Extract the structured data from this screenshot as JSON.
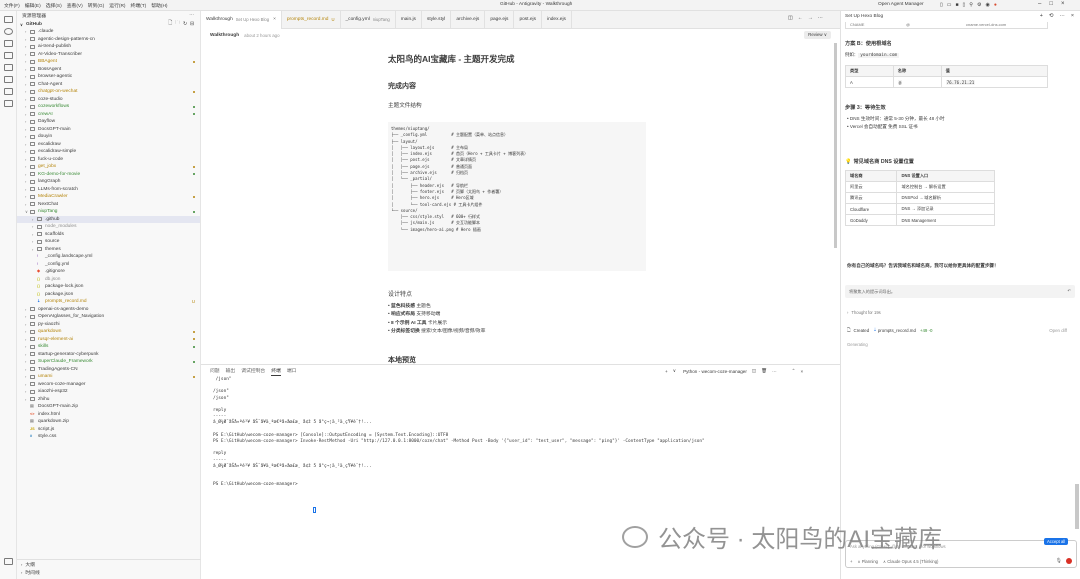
{
  "titlebar": {
    "menu": [
      "文件(F)",
      "编辑(E)",
      "选择(S)",
      "查看(V)",
      "转到(G)",
      "运行(R)",
      "终端(T)",
      "帮助(H)"
    ],
    "title": "GitHub - Antigravity - Walkthrough",
    "agent_manager": "Open Agent Manager"
  },
  "sidebar": {
    "title": "资源管理器",
    "root": "GitHub",
    "items": [
      {
        "t": "f",
        "d": 0,
        "label": ".claude",
        "c": "#3b3b3b"
      },
      {
        "t": "f",
        "d": 0,
        "label": "agentic-design-patterns-cn",
        "c": "#3b3b3b"
      },
      {
        "t": "f",
        "d": 0,
        "label": "ai-trend-publish",
        "c": "#3b3b3b"
      },
      {
        "t": "f",
        "d": 0,
        "label": "AI-Video-Transcriber",
        "c": "#3b3b3b"
      },
      {
        "t": "f",
        "d": 0,
        "label": "BBAgent",
        "c": "#b5850b",
        "dot": "#b5850b"
      },
      {
        "t": "f",
        "d": 0,
        "label": "BossAgent",
        "c": "#3b3b3b"
      },
      {
        "t": "f",
        "d": 0,
        "label": "browser-agentic",
        "c": "#3b3b3b"
      },
      {
        "t": "f",
        "d": 0,
        "label": "Chat-Agent",
        "c": "#3b3b3b"
      },
      {
        "t": "f",
        "d": 0,
        "label": "chatgpt-on-wechat",
        "c": "#b5850b",
        "dot": "#b5850b"
      },
      {
        "t": "f",
        "d": 0,
        "label": "coze-studio",
        "c": "#3b3b3b"
      },
      {
        "t": "f",
        "d": 0,
        "label": "cozeworkflows",
        "c": "#388a34",
        "dot": "#388a34"
      },
      {
        "t": "f",
        "d": 0,
        "label": "crewAI",
        "c": "#388a34",
        "dot": "#388a34"
      },
      {
        "t": "f",
        "d": 0,
        "label": "Dayflow",
        "c": "#3b3b3b"
      },
      {
        "t": "f",
        "d": 0,
        "label": "DocsGPT-main",
        "c": "#3b3b3b"
      },
      {
        "t": "f",
        "d": 0,
        "label": "douyin",
        "c": "#3b3b3b"
      },
      {
        "t": "f",
        "d": 0,
        "label": "excalidraw",
        "c": "#3b3b3b"
      },
      {
        "t": "f",
        "d": 0,
        "label": "excalidraw-simple",
        "c": "#3b3b3b"
      },
      {
        "t": "f",
        "d": 0,
        "label": "fuck-u-code",
        "c": "#3b3b3b"
      },
      {
        "t": "f",
        "d": 0,
        "label": "get_jobx",
        "c": "#b5850b",
        "dot": "#b5850b"
      },
      {
        "t": "f",
        "d": 0,
        "label": "KG-demo-for-movie",
        "c": "#388a34",
        "dot": "#388a34"
      },
      {
        "t": "f",
        "d": 0,
        "label": "langGraph",
        "c": "#3b3b3b"
      },
      {
        "t": "f",
        "d": 0,
        "label": "LLMs-from-scratch",
        "c": "#3b3b3b"
      },
      {
        "t": "f",
        "d": 0,
        "label": "MediaCrawler",
        "c": "#b5850b",
        "dot": "#b5850b"
      },
      {
        "t": "f",
        "d": 0,
        "label": "NextChat",
        "c": "#3b3b3b"
      },
      {
        "t": "o",
        "d": 0,
        "label": "niupTang",
        "c": "#388a34",
        "dot": "#388a34"
      },
      {
        "t": "f",
        "d": 1,
        "label": ".github",
        "c": "#3b3b3b",
        "sel": true
      },
      {
        "t": "f",
        "d": 1,
        "label": "node_modules",
        "c": "#8e8e8e"
      },
      {
        "t": "f",
        "d": 1,
        "label": "scaffolds",
        "c": "#3b3b3b"
      },
      {
        "t": "f",
        "d": 1,
        "label": "source",
        "c": "#3b3b3b"
      },
      {
        "t": "f",
        "d": 1,
        "label": "themes",
        "c": "#3b3b3b"
      },
      {
        "t": "y",
        "d": 1,
        "label": "_config.landscape.yml",
        "c": "#3b3b3b"
      },
      {
        "t": "y",
        "d": 1,
        "label": "_config.yml",
        "c": "#3b3b3b"
      },
      {
        "t": "g",
        "d": 1,
        "label": ".gitignore",
        "c": "#3b3b3b"
      },
      {
        "t": "x",
        "d": 1,
        "label": "db.json",
        "c": "#8e8e8e"
      },
      {
        "t": "x",
        "d": 1,
        "label": "package-lock.json",
        "c": "#3b3b3b"
      },
      {
        "t": "x",
        "d": 1,
        "label": "package.json",
        "c": "#3b3b3b"
      },
      {
        "t": "m",
        "d": 1,
        "label": "prompts_record.md",
        "c": "#b5850b",
        "badge": "U"
      },
      {
        "t": "f",
        "d": 0,
        "label": "openai-cs-agents-demo",
        "c": "#3b3b3b"
      },
      {
        "t": "f",
        "d": 0,
        "label": "OpenAIglasses_for_Navigation",
        "c": "#3b3b3b"
      },
      {
        "t": "f",
        "d": 0,
        "label": "py-xiaozhi",
        "c": "#3b3b3b"
      },
      {
        "t": "f",
        "d": 0,
        "label": "quarkdown",
        "c": "#b5850b",
        "dot": "#b5850b"
      },
      {
        "t": "f",
        "d": 0,
        "label": "rusqr-element-ai",
        "c": "#b5850b",
        "dot": "#b5850b"
      },
      {
        "t": "f",
        "d": 0,
        "label": "skills",
        "c": "#388a34",
        "dot": "#388a34"
      },
      {
        "t": "f",
        "d": 0,
        "label": "startup-generator-cyberpunk",
        "c": "#3b3b3b"
      },
      {
        "t": "f",
        "d": 0,
        "label": "SuperClaude_Framework",
        "c": "#388a34",
        "dot": "#388a34"
      },
      {
        "t": "f",
        "d": 0,
        "label": "TradingAgents-CN",
        "c": "#3b3b3b"
      },
      {
        "t": "f",
        "d": 0,
        "label": "umami",
        "c": "#b5850b",
        "dot": "#b5850b"
      },
      {
        "t": "f",
        "d": 0,
        "label": "wecom-coze-manager",
        "c": "#3b3b3b"
      },
      {
        "t": "f",
        "d": 0,
        "label": "xiaozhi-esp32",
        "c": "#3b3b3b"
      },
      {
        "t": "f",
        "d": 0,
        "label": "zhihu",
        "c": "#3b3b3b"
      },
      {
        "t": "z",
        "d": 0,
        "label": "DocsGPT-main.zip",
        "c": "#3b3b3b"
      },
      {
        "t": "h",
        "d": 0,
        "label": "index.html",
        "c": "#3b3b3b"
      },
      {
        "t": "z",
        "d": 0,
        "label": "quarkdown.zip",
        "c": "#3b3b3b"
      },
      {
        "t": "j",
        "d": 0,
        "label": "script.js",
        "c": "#3b3b3b"
      },
      {
        "t": "c",
        "d": 0,
        "label": "style.css",
        "c": "#3b3b3b"
      }
    ],
    "outline": "大纲",
    "timeline": "时间线"
  },
  "tabs": [
    {
      "label": "Walkthrough",
      "sub": "Set Up Hexo Blog",
      "active": true,
      "close": "×"
    },
    {
      "label": "prompts_record.md",
      "sub": "U",
      "color": "#b5850b"
    },
    {
      "label": "_config.yml",
      "sub": "niupTang"
    },
    {
      "label": "main.js"
    },
    {
      "label": "style.styl"
    },
    {
      "label": "archive.ejs"
    },
    {
      "label": "page.ejs"
    },
    {
      "label": "post.ejs"
    },
    {
      "label": "index.ejs"
    }
  ],
  "crumb": {
    "title": "Walkthrough",
    "time": "about 2 hours ago",
    "review": "Review"
  },
  "doc": {
    "h1": "太阳鸟的AI宝藏库 - 主题开发完成",
    "h2": "完成内容",
    "h3": "主题文件结构",
    "code": "themes/niuptang/\n├── _config.yml          # 主题配置（菜单、站点信息）\n├── layout/\n│   ├── layout.ejs       # 主布局\n│   ├── index.ejs        # 首页（Hero + 工具卡片 + 博客列表）\n│   ├── post.ejs         # 文章详情页\n│   ├── page.ejs         # 普通页面\n│   ├── archive.ejs      # 归档页\n│   └── _partial/\n│       ├── header.ejs   # 导航栏\n│       ├── footer.ejs   # 页脚（太阳鸟 + 作者署）\n│       ├── hero.ejs     # Hero区域\n│       └── tool-card.ejs # 工具卡片组件\n└── source/\n    ├── css/style.styl   # 600+ 行样式\n    ├── js/main.js       # 交互功能脚本\n    └── images/hero-ai.png # Hero 插画",
    "h2b": "设计特点",
    "bullets": [
      {
        "b": "蓝色科技感",
        "t": " 主题色"
      },
      {
        "b": "响应式布局",
        "t": " 支持移动端"
      },
      {
        "b": "8 个示例 AI 工具",
        "t": " 卡片展示"
      },
      {
        "b": "分类标签切换",
        "t": " 搜索/文本/图像/视频/音频/效率"
      }
    ],
    "h2c": "本地预览"
  },
  "panel": {
    "tabs": [
      "问题",
      "输出",
      "调试控制台",
      "终端",
      "端口"
    ],
    "active": 3,
    "shell": "Python - wecom-coze-manager"
  },
  "terminal": [
    " /json\"",
    "",
    "/json\"",
    "/json\"",
    "",
    "reply",
    "-----",
    "â¸Ø¾Ø¯åŠå¤ªé³¥ åŠ¨å¥ä¸ªæ€ªå¤åœ£æ¸ å¢ž 5 å°ç¬¦ä¸²ä¸­çŸ¥è¯†!...",
    "",
    "PS E:\\GitHub\\wecom-coze-manager> [Console]::OutputEncoding = [System.Text.Encoding]::UTF8",
    "PS E:\\GitHub\\wecom-coze-manager> Invoke-RestMethod -Uri \"http://127.0.0.1:8000/coze/chat\" -Method Post -Body '{\"user_id\": \"test_user\", \"message\": \"ping\"}' -ContentType \"application/json\"",
    "",
    "reply",
    "-----",
    "â¸Ø¾Ø¯åŠå¤ªé³¥ åŠ¨å¥ä¸ªæ€ªå¤åœ£æ¸ å¢ž 5 å°ç¬¦ä¸²ä¸­çŸ¥è¯†!...",
    "",
    "",
    "PS E:\\GitHub\\wecom-coze-manager> "
  ],
  "agent": {
    "title": "Set Up Hexo Blog",
    "partial_row": [
      "CNAME",
      "@",
      "",
      "cname.vercel-dns.com"
    ],
    "plan_b": "方案 B：使用根域名",
    "example_pre": "例如：",
    "example_code": "yourdomain.com",
    "table1": {
      "head": [
        "类型",
        "名称",
        "值"
      ],
      "row": [
        "A",
        "@",
        "76.76.21.21"
      ]
    },
    "step3": "步骤 3：等待生效",
    "bullets": [
      "DNS 生效时间：通常 5-30 分钟，最长 48 小时",
      "Vercel 会自动配置 免费 SSL 证书"
    ],
    "reg_title": "常见域名商 DNS 设置位置",
    "table2": {
      "head": [
        "域名商",
        "DNS 设置入口"
      ],
      "rows": [
        [
          "阿里云",
          "域名控制台 → 解析设置"
        ],
        [
          "腾讯云",
          "DNSPod → 域名解析"
        ],
        [
          "Cloudflare",
          "DNS → 添加记录"
        ],
        [
          "GoDaddy",
          "DNS Management"
        ]
      ]
    },
    "question": "你有自己的域名吗？告诉我域名和域名商，我可以给你更具体的配置步骤！",
    "input_hint": "将聚焦入的提示词导出。",
    "thought": "Thought for 19s",
    "created_pre": "Created",
    "created_file": "prompts_record.md",
    "created_stats": "+49 -0",
    "open_diff": "Open diff",
    "generating": "Generating",
    "ask_placeholder": "Ask anything (Ctrl+L), @ to mention, / for workflows",
    "planning": "Planning",
    "model": "Claude Opus 4.5 (Thinking)",
    "accept_all": "Accept all"
  },
  "watermark": {
    "prefix": "公众号 · 太阳鸟的AI宝藏库"
  }
}
